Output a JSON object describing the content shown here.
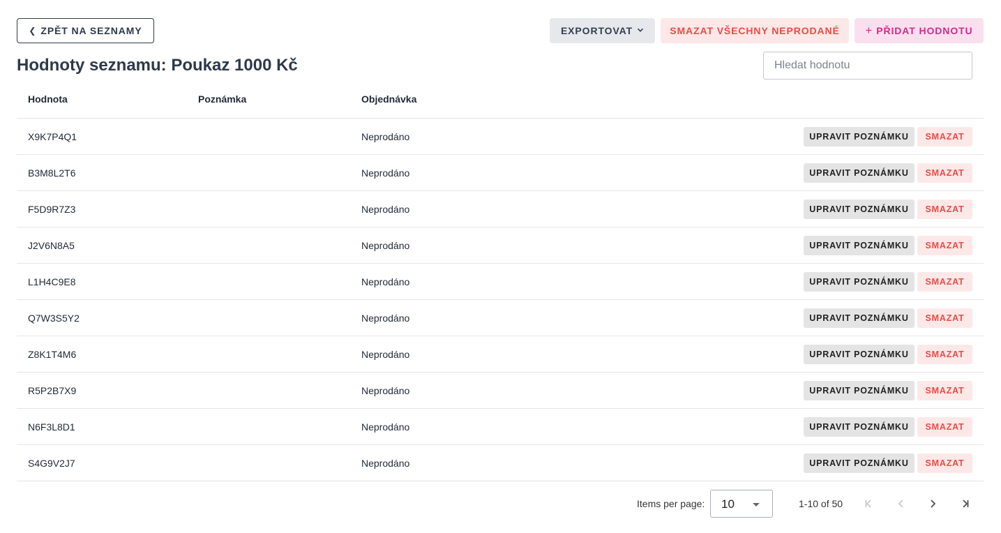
{
  "topbar": {
    "back_label": "ZPĚT NA SEZNAMY",
    "export_label": "EXPORTOVAT",
    "delete_all_label": "SMAZAT VŠECHNY NEPRODANÉ",
    "add_label": "PŘIDAT HODNOTU"
  },
  "page": {
    "title": "Hodnoty seznamu: Poukaz 1000 Kč"
  },
  "search": {
    "placeholder": "Hledat hodnotu",
    "value": ""
  },
  "table": {
    "columns": [
      "Hodnota",
      "Poznámka",
      "Objednávka"
    ],
    "edit_label": "UPRAVIT POZNÁMKU",
    "delete_label": "SMAZAT",
    "rows": [
      {
        "value": "X9K7P4Q1",
        "note": "",
        "order": "Neprodáno"
      },
      {
        "value": "B3M8L2T6",
        "note": "",
        "order": "Neprodáno"
      },
      {
        "value": "F5D9R7Z3",
        "note": "",
        "order": "Neprodáno"
      },
      {
        "value": "J2V6N8A5",
        "note": "",
        "order": "Neprodáno"
      },
      {
        "value": "L1H4C9E8",
        "note": "",
        "order": "Neprodáno"
      },
      {
        "value": "Q7W3S5Y2",
        "note": "",
        "order": "Neprodáno"
      },
      {
        "value": "Z8K1T4M6",
        "note": "",
        "order": "Neprodáno"
      },
      {
        "value": "R5P2B7X9",
        "note": "",
        "order": "Neprodáno"
      },
      {
        "value": "N6F3L8D1",
        "note": "",
        "order": "Neprodáno"
      },
      {
        "value": "S4G9V2J7",
        "note": "",
        "order": "Neprodáno"
      }
    ]
  },
  "paginator": {
    "items_per_page_label": "Items per page:",
    "items_per_page_value": "10",
    "range_label": "1-10 of 50"
  },
  "colors": {
    "primary_text": "#2d3a4a",
    "danger": "#ec4b43",
    "danger_bg": "#fde8e8",
    "accent_pink": "#d62a87",
    "accent_pink_bg": "#fae0ef"
  }
}
